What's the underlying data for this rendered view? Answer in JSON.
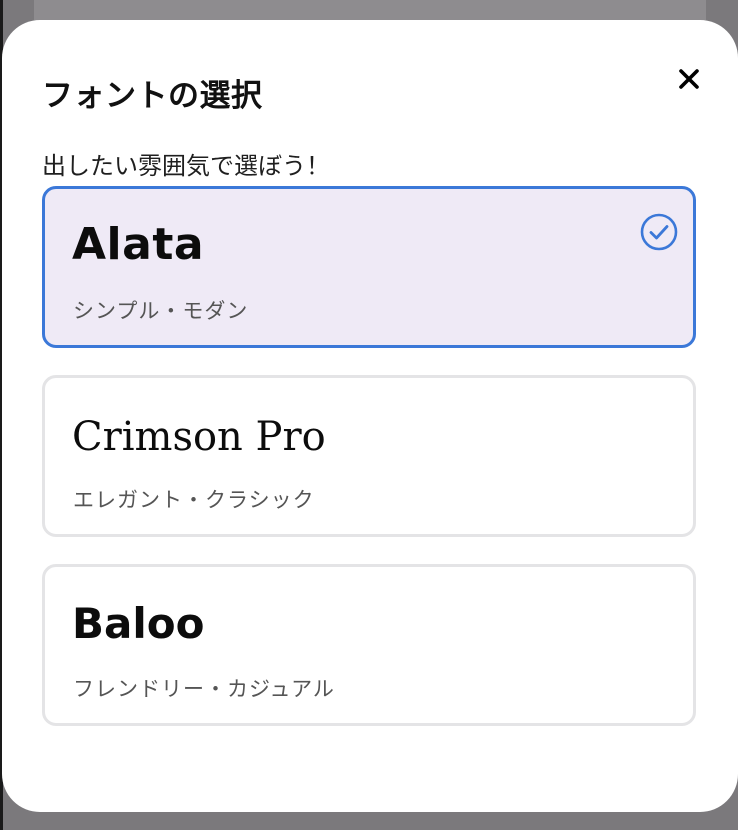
{
  "modal": {
    "title": "フォントの選択",
    "subtitle": "出したい雰囲気で選ぼう！",
    "close_icon": "close-icon"
  },
  "font_options": [
    {
      "name": "Alata",
      "description": "シンプル・モダン",
      "selected": true
    },
    {
      "name": "Crimson Pro",
      "description": "エレガント・クラシック",
      "selected": false
    },
    {
      "name": "Baloo",
      "description": "フレンドリー・カジュアル",
      "selected": false
    }
  ],
  "colors": {
    "accent": "#3b78d8",
    "selected_background": "#efeaf6",
    "card_border": "#e4e4e6",
    "overlay": "#7b797c"
  },
  "icons": {
    "selected_indicator": "check-circle-icon"
  }
}
